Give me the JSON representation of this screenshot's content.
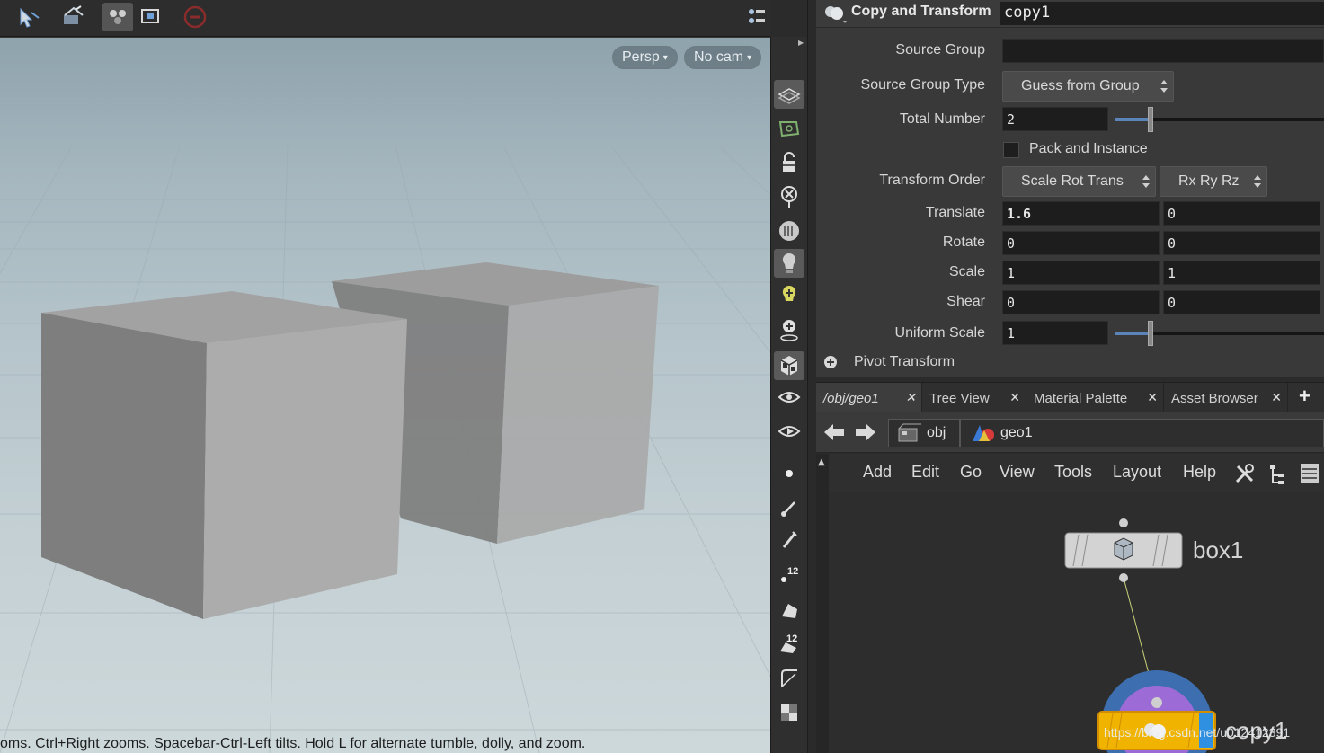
{
  "viewport": {
    "camera_view": "Persp",
    "camera": "No cam",
    "status_text": "oms. Ctrl+Right zooms. Spacebar-Ctrl-Left tilts. Hold L for alternate tumble, dolly, and zoom."
  },
  "params": {
    "node_type": "Copy and Transform",
    "node_name": "copy1",
    "source_group": {
      "label": "Source Group",
      "value": ""
    },
    "source_group_type": {
      "label": "Source Group Type",
      "value": "Guess from Group"
    },
    "total_number": {
      "label": "Total Number",
      "value": "2",
      "slider_fraction": 0.17
    },
    "pack_instance": {
      "label": "Pack and Instance",
      "checked": false
    },
    "transform_order": {
      "label": "Transform Order",
      "order": "Scale Rot Trans",
      "rot_order": "Rx Ry Rz"
    },
    "translate": {
      "label": "Translate",
      "x": "1.6",
      "y": "0"
    },
    "rotate": {
      "label": "Rotate",
      "x": "0",
      "y": "0"
    },
    "scale": {
      "label": "Scale",
      "x": "1",
      "y": "1"
    },
    "shear": {
      "label": "Shear",
      "x": "0",
      "y": "0"
    },
    "uniform_scale": {
      "label": "Uniform Scale",
      "value": "1",
      "slider_fraction": 0.17
    },
    "pivot_transform": {
      "label": "Pivot Transform"
    }
  },
  "network": {
    "tabs": [
      {
        "label": "/obj/geo1"
      },
      {
        "label": "Tree View"
      },
      {
        "label": "Material Palette"
      },
      {
        "label": "Asset Browser"
      }
    ],
    "add_tab_glyph": "+",
    "path": {
      "root": "obj",
      "child": "geo1"
    },
    "menus": [
      "Add",
      "Edit",
      "Go",
      "View",
      "Tools",
      "Layout",
      "Help"
    ],
    "nodes": {
      "box": "box1",
      "copy": "copy1"
    },
    "watermark": "https://blog.csdn.net/u012412391"
  },
  "icons": {
    "toolbar": [
      "select-arrow-icon",
      "move-camera-icon",
      "snap-icon",
      "display-options-icon",
      "disabled-icon",
      "viewport-layout-icon",
      "help-icon"
    ],
    "shelf": [
      "grid-plane-icon",
      "template-icon",
      "lock-icon",
      "ghost-icon",
      "background-icon",
      "light-bulb-icon",
      "add-light-icon",
      "add-light-ring-icon",
      "shaded-cube-icon",
      "visualizer-icon",
      "render-icon",
      "point-icon",
      "brush-icon",
      "pick-icon",
      "point-number-icon",
      "prim-icon",
      "prim-number-icon",
      "curve-icon",
      "uv-icon"
    ]
  },
  "colors": {
    "accent": "#5b84b8",
    "node_copy": "#f0b400",
    "node_copy_ring": "#9d6bd6",
    "node_copy_ring_outer": "#3d6fb0"
  }
}
